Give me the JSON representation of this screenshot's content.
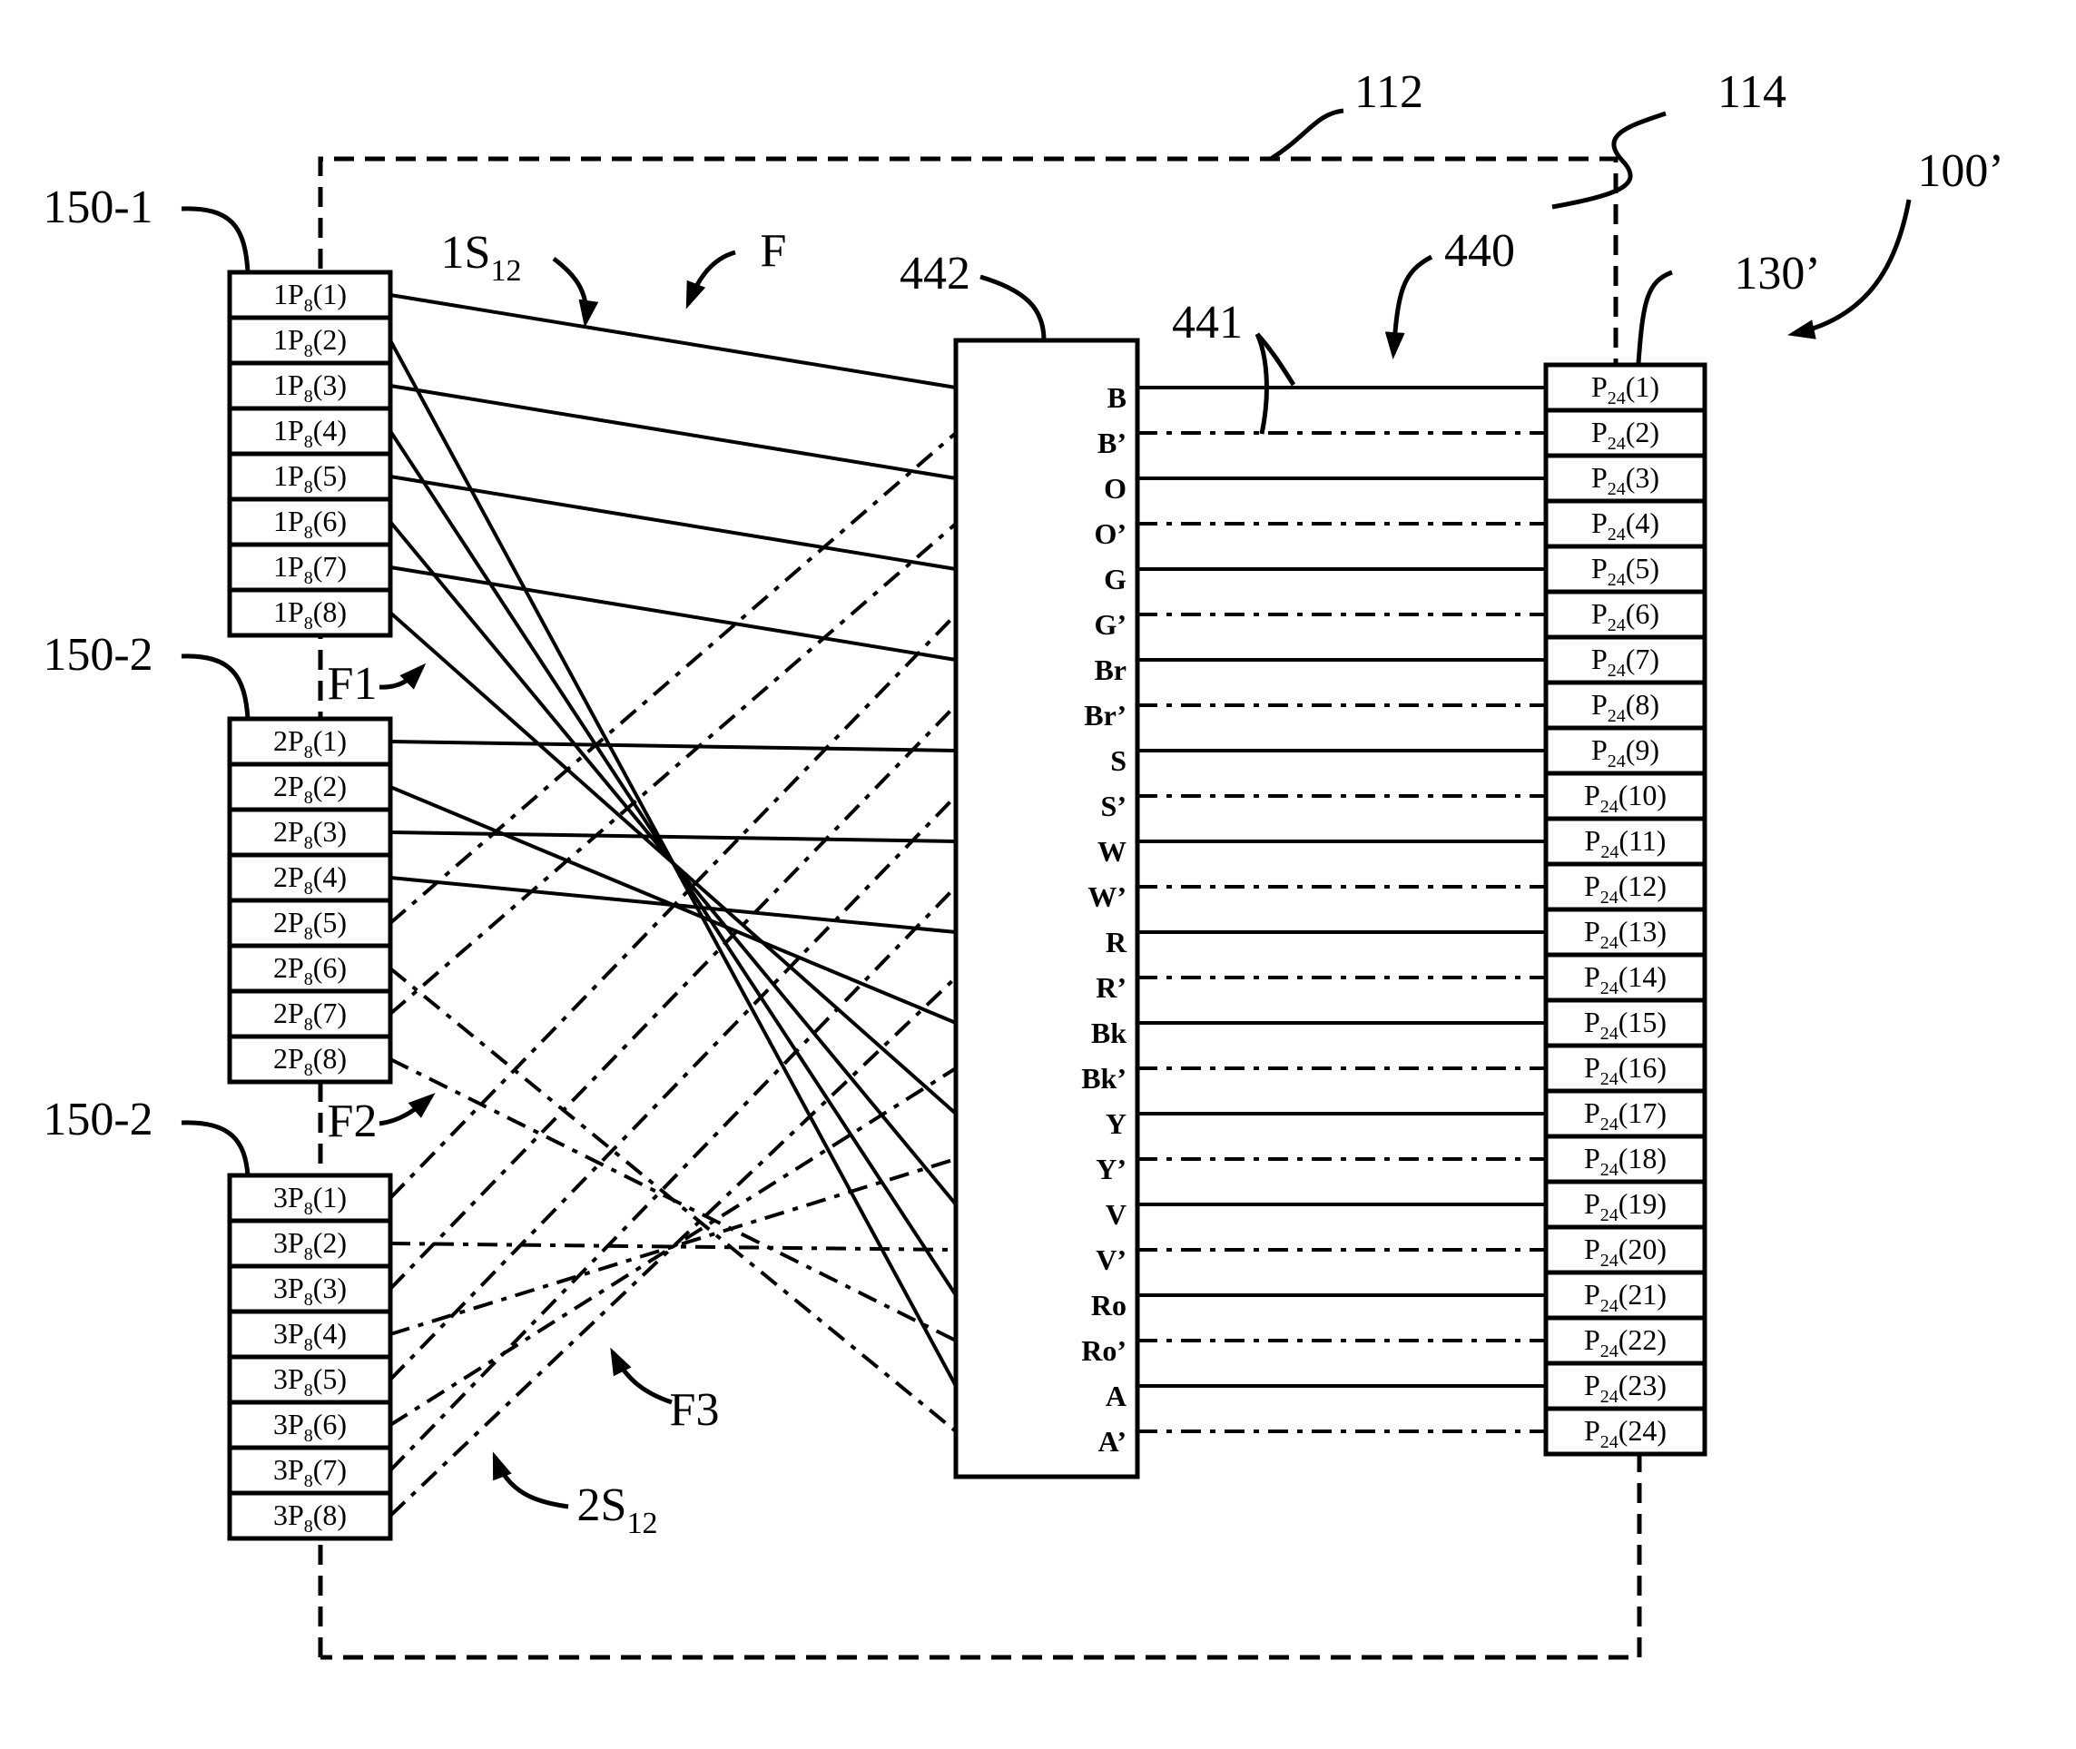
{
  "figure": {
    "reference_labels": {
      "system": "100’",
      "enclosure": "112",
      "enclosure_wall": "114",
      "output_connector": "130’",
      "input_group_1": "150-1",
      "input_group_2": "150-2",
      "input_group_3": "150-2",
      "wiring_assembly": "440",
      "wires": "441",
      "color_block": "442",
      "fanout": "F",
      "fanout_1": "F1",
      "fanout_2": "F2",
      "fanout_3": "F3",
      "segment_1": "1S",
      "segment_1_sub": "12",
      "segment_2": "2S",
      "segment_2_sub": "12"
    },
    "input_groups": [
      {
        "prefix": "1P",
        "sub": "8",
        "ports": [
          "(1)",
          "(2)",
          "(3)",
          "(4)",
          "(5)",
          "(6)",
          "(7)",
          "(8)"
        ]
      },
      {
        "prefix": "2P",
        "sub": "8",
        "ports": [
          "(1)",
          "(2)",
          "(3)",
          "(4)",
          "(5)",
          "(6)",
          "(7)",
          "(8)"
        ]
      },
      {
        "prefix": "3P",
        "sub": "8",
        "ports": [
          "(1)",
          "(2)",
          "(3)",
          "(4)",
          "(5)",
          "(6)",
          "(7)",
          "(8)"
        ]
      }
    ],
    "color_codes": [
      "B",
      "B’",
      "O",
      "O’",
      "G",
      "G’",
      "Br",
      "Br’",
      "S",
      "S’",
      "W",
      "W’",
      "R",
      "R’",
      "Bk",
      "Bk’",
      "Y",
      "Y’",
      "V",
      "V’",
      "Ro",
      "Ro’",
      "A",
      "A’"
    ],
    "output_connector": {
      "prefix": "P",
      "sub": "24",
      "ports": [
        "(1)",
        "(2)",
        "(3)",
        "(4)",
        "(5)",
        "(6)",
        "(7)",
        "(8)",
        "(9)",
        "(10)",
        "(11)",
        "(12)",
        "(13)",
        "(14)",
        "(15)",
        "(16)",
        "(17)",
        "(18)",
        "(19)",
        "(20)",
        "(21)",
        "(22)",
        "(23)",
        "(24)"
      ]
    },
    "wiring": [
      {
        "from_group": 1,
        "from_port": 1,
        "to_color": 0,
        "style": "solid"
      },
      {
        "from_group": 1,
        "from_port": 3,
        "to_color": 2,
        "style": "solid"
      },
      {
        "from_group": 1,
        "from_port": 5,
        "to_color": 4,
        "style": "solid"
      },
      {
        "from_group": 1,
        "from_port": 7,
        "to_color": 6,
        "style": "solid"
      },
      {
        "from_group": 2,
        "from_port": 1,
        "to_color": 8,
        "style": "solid"
      },
      {
        "from_group": 2,
        "from_port": 3,
        "to_color": 10,
        "style": "solid"
      },
      {
        "from_group": 2,
        "from_port": 4,
        "to_color": 12,
        "style": "solid"
      },
      {
        "from_group": 2,
        "from_port": 2,
        "to_color": 14,
        "style": "solid"
      },
      {
        "from_group": 1,
        "from_port": 8,
        "to_color": 16,
        "style": "solid"
      },
      {
        "from_group": 1,
        "from_port": 6,
        "to_color": 18,
        "style": "solid"
      },
      {
        "from_group": 1,
        "from_port": 4,
        "to_color": 20,
        "style": "solid"
      },
      {
        "from_group": 1,
        "from_port": 2,
        "to_color": 22,
        "style": "solid"
      },
      {
        "from_group": 2,
        "from_port": 5,
        "to_color": 1,
        "style": "dashdot"
      },
      {
        "from_group": 2,
        "from_port": 7,
        "to_color": 3,
        "style": "dashdot"
      },
      {
        "from_group": 3,
        "from_port": 1,
        "to_color": 5,
        "style": "dashdot"
      },
      {
        "from_group": 3,
        "from_port": 3,
        "to_color": 7,
        "style": "dashdot"
      },
      {
        "from_group": 3,
        "from_port": 5,
        "to_color": 9,
        "style": "dashdot"
      },
      {
        "from_group": 3,
        "from_port": 7,
        "to_color": 11,
        "style": "dashdot"
      },
      {
        "from_group": 3,
        "from_port": 8,
        "to_color": 13,
        "style": "dashdot"
      },
      {
        "from_group": 3,
        "from_port": 6,
        "to_color": 15,
        "style": "dashdot"
      },
      {
        "from_group": 3,
        "from_port": 4,
        "to_color": 17,
        "style": "dashdot"
      },
      {
        "from_group": 3,
        "from_port": 2,
        "to_color": 19,
        "style": "dashdot"
      },
      {
        "from_group": 2,
        "from_port": 8,
        "to_color": 21,
        "style": "dashdot"
      },
      {
        "from_group": 2,
        "from_port": 6,
        "to_color": 23,
        "style": "dashdot"
      }
    ]
  }
}
